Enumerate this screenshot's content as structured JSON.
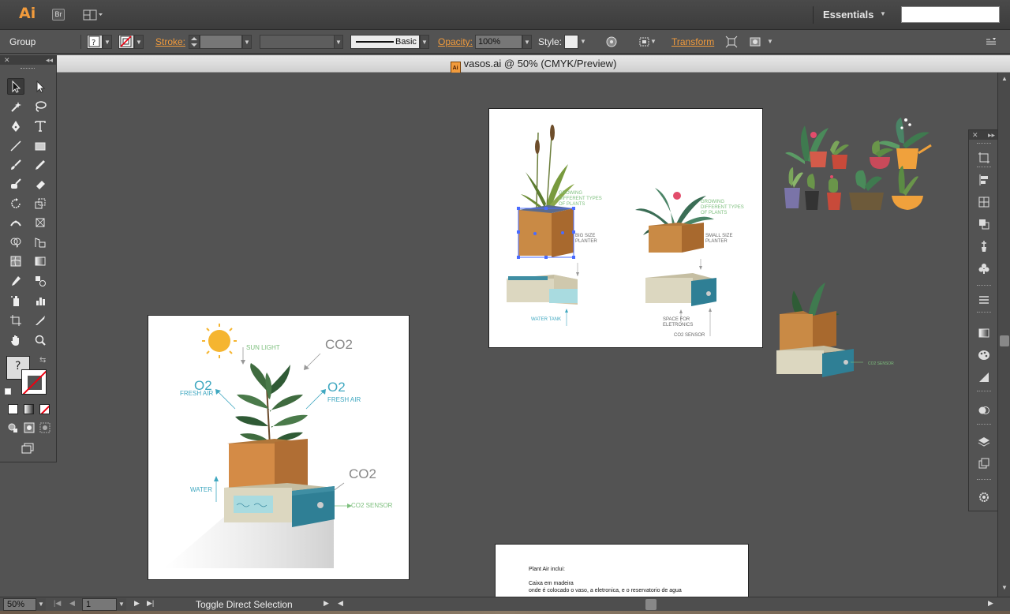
{
  "app": {
    "logo": "Ai",
    "bridge_label": "Br",
    "workspace": "Essentials",
    "search_value": ""
  },
  "controlbar": {
    "selection_type": "Group",
    "stroke_label": "Stroke:",
    "brush_label": "Basic",
    "opacity_label": "Opacity:",
    "opacity_value": "100%",
    "style_label": "Style:",
    "transform_label": "Transform"
  },
  "document": {
    "title": "vasos.ai @ 50% (CMYK/Preview)",
    "file_icon_label": "Ai"
  },
  "artboards": {
    "planters": {
      "label_growing_1": "GROWING DIFFERENT TYPES OF PLANTS",
      "label_growing_2": "GROWING DIFFERENT TYPES OF PLANTS",
      "label_big": "BIG SIZE PLANTER",
      "label_small": "SMALL SIZE PLANTER",
      "label_water_tank": "WATER TANK",
      "label_space": "SPACE FOR ELETRONICS",
      "label_co2_sensor": "CO2 SENSOR"
    },
    "diagram": {
      "sun_light": "SUN LIGHT",
      "co2_top": "CO2",
      "o2_left": "O2",
      "fresh_air_left": "FRESH AIR",
      "o2_right": "O2",
      "fresh_air_right": "FRESH AIR",
      "co2_bottom": "CO2",
      "water": "WATER",
      "co2_sensor": "CO2 SENSOR"
    },
    "text_doc": {
      "line1": "Plant Air inclui:",
      "line2": "Caixa em madeira",
      "line3": "onde é colocado o vaso, a eletronica, e o reservatorio de agua"
    },
    "loose": {
      "co2_sensor": "CO2 SENSOR"
    }
  },
  "statusbar": {
    "zoom": "50%",
    "artboard_number": "1",
    "status_text": "Toggle Direct Selection"
  },
  "colors": {
    "accent_orange": "#f29b3c",
    "planter_wood": "#c98a45",
    "tank_teal": "#2f7f95",
    "tank_beige": "#dcd7c0",
    "leaf_green": "#3f6b3f",
    "label_green": "#7dbf7d",
    "label_teal": "#3ea7c0"
  }
}
